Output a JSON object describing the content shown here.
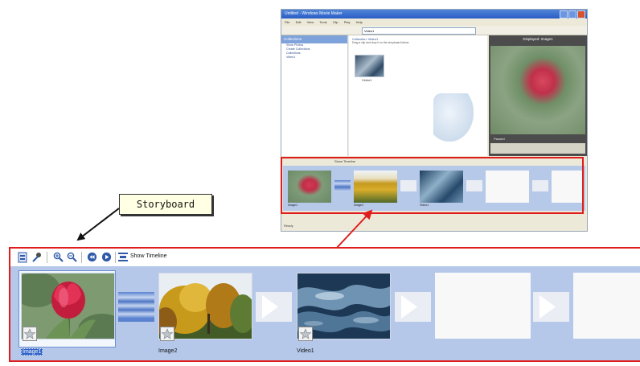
{
  "callout": {
    "label": "Storyboard"
  },
  "thumbnail_window": {
    "title": "Untitled - Windows Movie Maker",
    "menu": [
      "File",
      "Edit",
      "View",
      "Tools",
      "Clip",
      "Play",
      "Help"
    ],
    "address": "Video1",
    "tasks_header": "Collections",
    "task_links": [
      "Show Photos",
      "Create Collections",
      "Collections",
      "Video1"
    ],
    "collection_title": "Collection: Video1",
    "collection_hint": "Drag a clip and drop it on the storyboard below.",
    "collection_clip_name": "Video1",
    "preview_title": "Displayed: Image1",
    "preview_status": "Paused",
    "storyboard_toolbar_label": "Show Timeline",
    "clip_titles": [
      "Image1",
      "Image2",
      "Video1"
    ],
    "status_bar": "Ready"
  },
  "storyboard": {
    "toolbar": {
      "show_timeline_label": "Show Timeline"
    },
    "clips": [
      {
        "name": "Image1",
        "image": "tulip",
        "selected": true
      },
      {
        "name": "Image2",
        "image": "autumn-trees",
        "selected": false
      },
      {
        "name": "Video1",
        "image": "water",
        "selected": false
      }
    ],
    "transitions": [
      "filled",
      "empty",
      "empty",
      "empty"
    ],
    "empty_slots": 2
  },
  "colors": {
    "highlight_border": "#e01c1c",
    "storyboard_bg": "#b5c8ea",
    "selection_blue": "#2f63c9",
    "callout_bg": "#ffffe3"
  }
}
